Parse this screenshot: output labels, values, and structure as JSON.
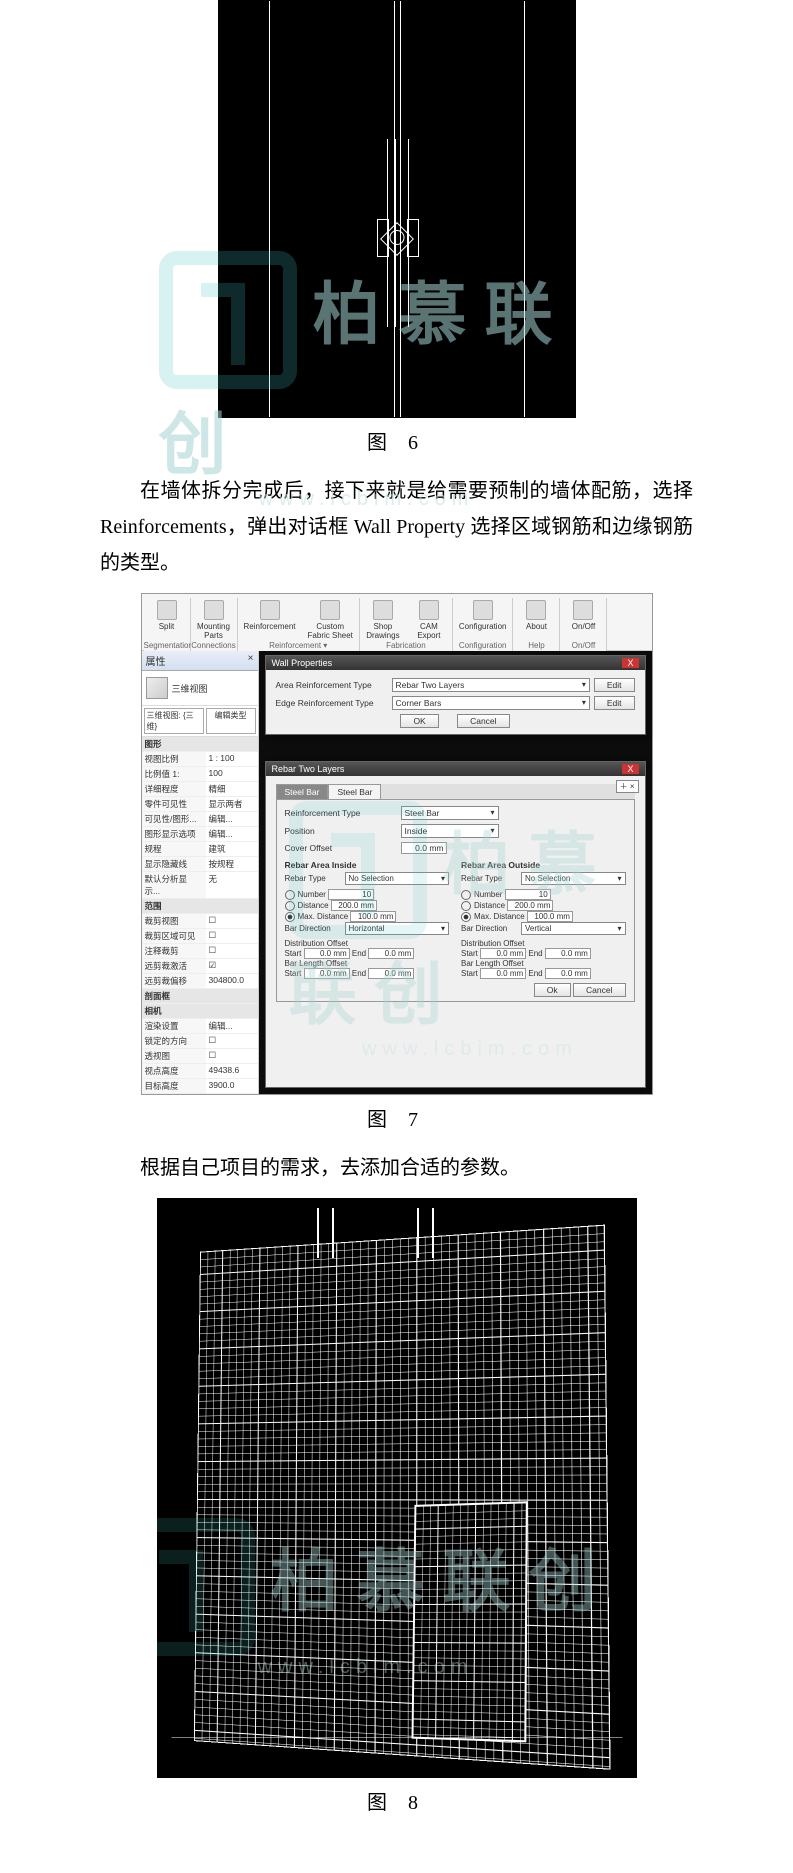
{
  "figure6": {
    "caption": "图 6"
  },
  "para1": "在墙体拆分完成后，接下来就是给需要预制的墙体配筋，选择 Reinforcements，弹出对话框 Wall Property 选择区域钢筋和边缘钢筋的类型。",
  "watermark": {
    "text": "柏慕联创",
    "sub": "www.lcbim.com"
  },
  "ribbon": {
    "groups": [
      {
        "label": "Segmentation",
        "buttons": [
          "Split"
        ]
      },
      {
        "label": "Connections",
        "buttons": [
          "Mounting Parts"
        ]
      },
      {
        "label": "Reinforcement ▾",
        "buttons": [
          "Reinforcement",
          "Custom Fabric Sheet"
        ]
      },
      {
        "label": "Fabrication",
        "buttons": [
          "Shop Drawings",
          "CAM Export"
        ]
      },
      {
        "label": "Configuration",
        "buttons": [
          "Configuration"
        ]
      },
      {
        "label": "Help",
        "buttons": [
          "About"
        ]
      },
      {
        "label": "On/Off",
        "buttons": [
          "On/Off"
        ]
      }
    ]
  },
  "props": {
    "title": "属性",
    "view_type": "三维视图",
    "selector": "三维视图: {三维}",
    "edit_type": "编辑类型",
    "sections": [
      {
        "header": "图形",
        "rows": [
          {
            "k": "视图比例",
            "v": "1 : 100"
          },
          {
            "k": "比例值 1:",
            "v": "100"
          },
          {
            "k": "详细程度",
            "v": "精细"
          },
          {
            "k": "零件可见性",
            "v": "显示两者"
          },
          {
            "k": "可见性/图形...",
            "v": "编辑..."
          },
          {
            "k": "图形显示选项",
            "v": "编辑..."
          },
          {
            "k": "规程",
            "v": "建筑"
          },
          {
            "k": "显示隐藏线",
            "v": "按规程"
          },
          {
            "k": "默认分析显示...",
            "v": "无"
          }
        ]
      },
      {
        "header": "范围",
        "rows": [
          {
            "k": "裁剪视图",
            "v": "☐"
          },
          {
            "k": "裁剪区域可见",
            "v": "☐"
          },
          {
            "k": "注释裁剪",
            "v": "☐"
          },
          {
            "k": "远剪裁激活",
            "v": "☑"
          },
          {
            "k": "远剪裁偏移",
            "v": "304800.0"
          }
        ]
      },
      {
        "header": "剖面框",
        "rows": []
      },
      {
        "header": "相机",
        "rows": [
          {
            "k": "渲染设置",
            "v": "编辑..."
          },
          {
            "k": "锁定的方向",
            "v": "☐"
          },
          {
            "k": "透视图",
            "v": "☐"
          },
          {
            "k": "视点高度",
            "v": "49438.6"
          },
          {
            "k": "目标高度",
            "v": "3900.0"
          }
        ]
      }
    ]
  },
  "dlg1": {
    "title": "Wall Properties",
    "rows": [
      {
        "label": "Area Reinforcement Type",
        "value": "Rebar Two Layers",
        "btn": "Edit"
      },
      {
        "label": "Edge Reinforcement Type",
        "value": "Corner Bars",
        "btn": "Edit"
      }
    ],
    "ok": "OK",
    "cancel": "Cancel"
  },
  "dlg2": {
    "title": "Rebar Two Layers",
    "tabs": [
      "Steel Bar",
      "Steel Bar"
    ],
    "reinf_type_label": "Reinforcement Type",
    "reinf_type": "Steel Bar",
    "position_label": "Position",
    "position": "Inside",
    "cover_label": "Cover Offset",
    "cover": "0.0 mm",
    "inside_hdr": "Rebar Area Inside",
    "outside_hdr": "Rebar Area Outside",
    "rebar_type_label": "Rebar Type",
    "rebar_type": "No Selection",
    "number_label": "Number",
    "number": "10",
    "distance_label": "Distance",
    "distance": "200.0 mm",
    "maxdist_label": "Max. Distance",
    "maxdist": "100.0 mm",
    "bardir_label": "Bar Direction",
    "bardir_in": "Horizontal",
    "bardir_out": "Vertical",
    "distoff_label": "Distribution Offset",
    "barlen_label": "Bar Length Offset",
    "start": "Start",
    "end": "End",
    "zero": "0.0 mm",
    "ok": "Ok",
    "cancel": "Cancel"
  },
  "figure7": {
    "caption": "图 7"
  },
  "para2": "根据自己项目的需求，去添加合适的参数。",
  "figure8": {
    "caption": "图 8"
  }
}
